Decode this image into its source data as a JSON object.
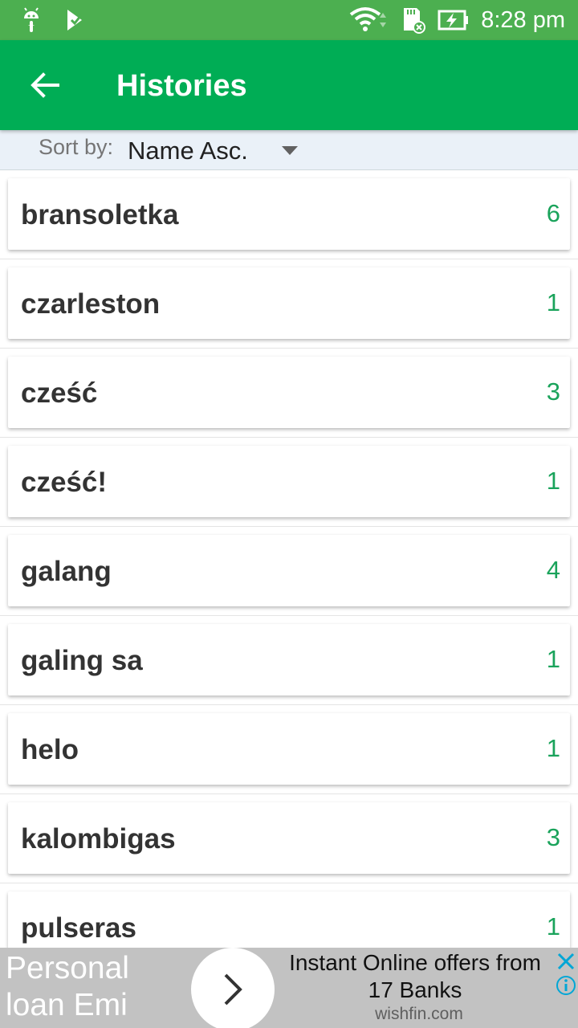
{
  "status_bar": {
    "time": "8:28 pm",
    "left_icons": [
      "android-icon",
      "checkmark-task-icon"
    ],
    "right_icons": [
      "wifi-icon",
      "sd-card-icon",
      "battery-charging-icon"
    ]
  },
  "app_bar": {
    "back_icon": "arrow-left-icon",
    "title": "Histories",
    "color": "#00ad55"
  },
  "sort": {
    "label": "Sort by:",
    "selected": "Name Asc."
  },
  "histories": [
    {
      "name": "bransoletka",
      "count": "6"
    },
    {
      "name": "czarleston",
      "count": "1"
    },
    {
      "name": "cześć",
      "count": "3"
    },
    {
      "name": "cześć!",
      "count": "1"
    },
    {
      "name": "galang",
      "count": "4"
    },
    {
      "name": "galing sa",
      "count": "1"
    },
    {
      "name": "helo",
      "count": "1"
    },
    {
      "name": "kalombigas",
      "count": "3"
    },
    {
      "name": "pulseras",
      "count": "1"
    }
  ],
  "ad": {
    "left_text_line1": "Personal",
    "left_text_line2": "loan Emi",
    "headline_line1": "Instant Online offers from",
    "headline_line2": "17 Banks",
    "domain": "wishfin.com",
    "accent": "#00a6d6"
  }
}
